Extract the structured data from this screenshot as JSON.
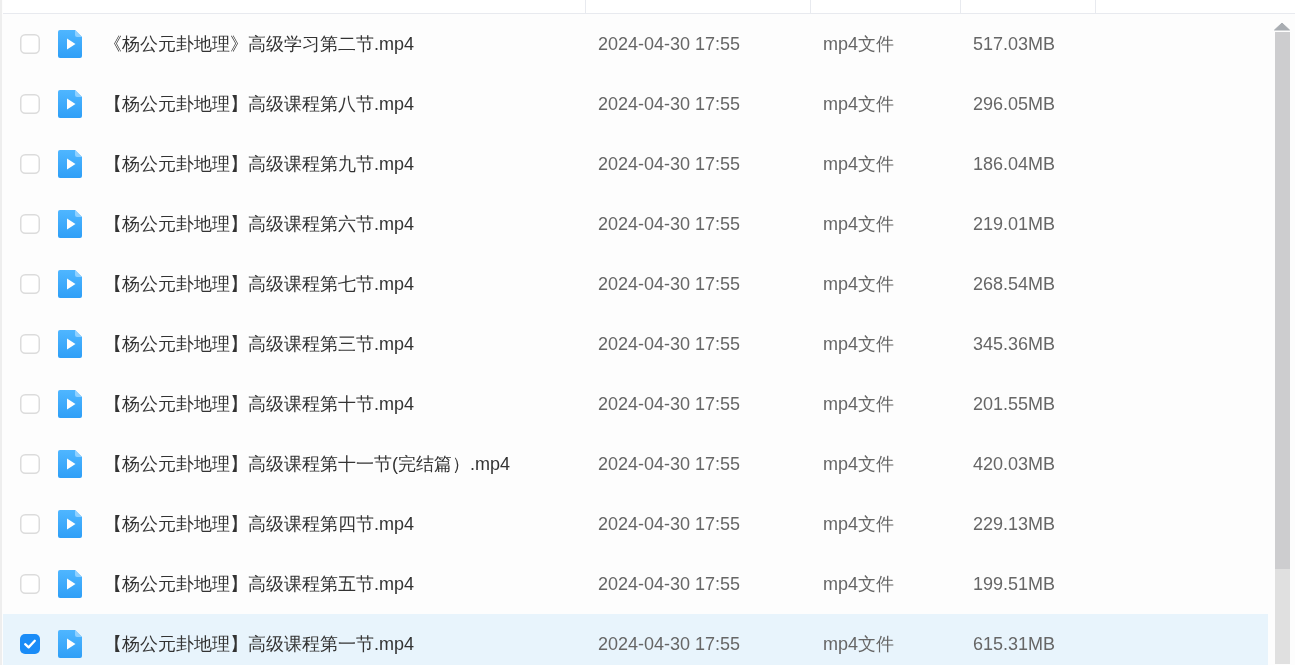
{
  "table": {
    "rows": [
      {
        "name": "《杨公元卦地理》高级学习第二节.mp4",
        "modified": "2024-04-30 17:55",
        "type": "mp4文件",
        "size": "517.03MB",
        "selected": false
      },
      {
        "name": "【杨公元卦地理】高级课程第八节.mp4",
        "modified": "2024-04-30 17:55",
        "type": "mp4文件",
        "size": "296.05MB",
        "selected": false
      },
      {
        "name": "【杨公元卦地理】高级课程第九节.mp4",
        "modified": "2024-04-30 17:55",
        "type": "mp4文件",
        "size": "186.04MB",
        "selected": false
      },
      {
        "name": "【杨公元卦地理】高级课程第六节.mp4",
        "modified": "2024-04-30 17:55",
        "type": "mp4文件",
        "size": "219.01MB",
        "selected": false
      },
      {
        "name": "【杨公元卦地理】高级课程第七节.mp4",
        "modified": "2024-04-30 17:55",
        "type": "mp4文件",
        "size": "268.54MB",
        "selected": false
      },
      {
        "name": "【杨公元卦地理】高级课程第三节.mp4",
        "modified": "2024-04-30 17:55",
        "type": "mp4文件",
        "size": "345.36MB",
        "selected": false
      },
      {
        "name": "【杨公元卦地理】高级课程第十节.mp4",
        "modified": "2024-04-30 17:55",
        "type": "mp4文件",
        "size": "201.55MB",
        "selected": false
      },
      {
        "name": "【杨公元卦地理】高级课程第十一节(完结篇）.mp4",
        "modified": "2024-04-30 17:55",
        "type": "mp4文件",
        "size": "420.03MB",
        "selected": false
      },
      {
        "name": "【杨公元卦地理】高级课程第四节.mp4",
        "modified": "2024-04-30 17:55",
        "type": "mp4文件",
        "size": "229.13MB",
        "selected": false
      },
      {
        "name": "【杨公元卦地理】高级课程第五节.mp4",
        "modified": "2024-04-30 17:55",
        "type": "mp4文件",
        "size": "199.51MB",
        "selected": false
      },
      {
        "name": "【杨公元卦地理】高级课程第一节.mp4",
        "modified": "2024-04-30 17:55",
        "type": "mp4文件",
        "size": "615.31MB",
        "selected": true
      }
    ]
  }
}
